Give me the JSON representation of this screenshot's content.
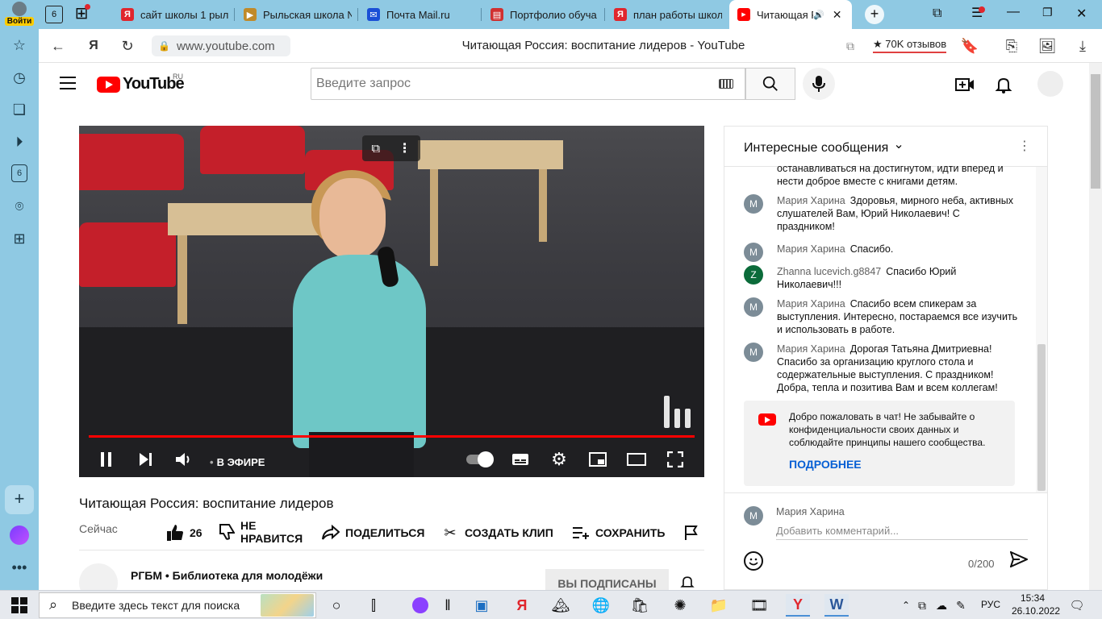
{
  "browser": {
    "tabs": [
      {
        "label": "сайт школы 1 рыл",
        "icon": "yandex-icon",
        "color": "#e0262d"
      },
      {
        "label": "Рыльская школа №",
        "icon": "site-icon",
        "color": "#c08a2a"
      },
      {
        "label": "Почта Mail.ru",
        "icon": "mail-icon",
        "color": "#1a4fd6"
      },
      {
        "label": "Портфолио обуча",
        "icon": "document-icon",
        "color": "#d03030"
      },
      {
        "label": "план работы школ",
        "icon": "yandex-icon",
        "color": "#e0262d"
      },
      {
        "label": "Читающая Р",
        "icon": "youtube-icon",
        "color": "#ff0000",
        "active": true
      }
    ],
    "profile_label": "Войти",
    "tab_count_badge": "6",
    "url": "www.youtube.com",
    "page_title": "Читающая Россия: воспитание лидеров - YouTube",
    "reviews_label": "70K отзывов",
    "sidebar_badge": "6"
  },
  "youtube": {
    "logo_text": "YouTube",
    "region": "RU",
    "search_placeholder": "Введите запрос"
  },
  "video": {
    "live_label": "В ЭФИРЕ",
    "title": "Читающая Россия: воспитание лидеров",
    "date_label": "Сейчас",
    "likes": "26",
    "dislike_label_1": "НЕ",
    "dislike_label_2": "НРАВИТСЯ",
    "share_label": "ПОДЕЛИТЬСЯ",
    "clip_label": "СОЗДАТЬ КЛИП",
    "save_label": "СОХРАНИТЬ",
    "channel_name": "РГБМ • Библиотека для молодёжи",
    "subscribed_label": "ВЫ ПОДПИСАНЫ"
  },
  "chat": {
    "header_title": "Интересные сообщения",
    "cut_text": "останавливаться на достигнутом, идти вперед и нести доброе вместе с книгами детям.",
    "messages": [
      {
        "avatar": "M",
        "avatar_color": "#7c8c97",
        "author": "Мария Харина",
        "text": "Здоровья, мирного неба, активных слушателей Вам, Юрий Николаевич! С праздником!"
      },
      {
        "avatar": "M",
        "avatar_color": "#7c8c97",
        "author": "Мария Харина",
        "text": "Спасибо."
      },
      {
        "avatar": "Z",
        "avatar_color": "#0b6b3a",
        "author": "Zhanna lucevich.g8847",
        "text": "Спасибо Юрий Николаевич!!!"
      },
      {
        "avatar": "M",
        "avatar_color": "#7c8c97",
        "author": "Мария Харина",
        "text": "Спасибо всем спикерам за выступления. Интересно, постараемся все изучить и использовать в работе."
      },
      {
        "avatar": "M",
        "avatar_color": "#7c8c97",
        "author": "Мария Харина",
        "text": "Дорогая Татьяна Дмитриевна! Спасибо за организацию круглого стола и содержательные выступления. С праздником! Добра, тепла и позитива Вам и всем коллегам!"
      }
    ],
    "welcome_text": "Добро пожаловать в чат! Не забывайте о конфиденциальности своих данных и соблюдайте принципы нашего сообщества.",
    "welcome_more": "ПОДРОБНЕЕ",
    "input_avatar": "M",
    "input_user": "Мария Харина",
    "input_placeholder": "Добавить комментарий...",
    "char_count": "0/200"
  },
  "taskbar": {
    "search_placeholder": "Введите здесь текст для поиска",
    "language": "РУС",
    "time": "15:34",
    "date": "26.10.2022"
  }
}
